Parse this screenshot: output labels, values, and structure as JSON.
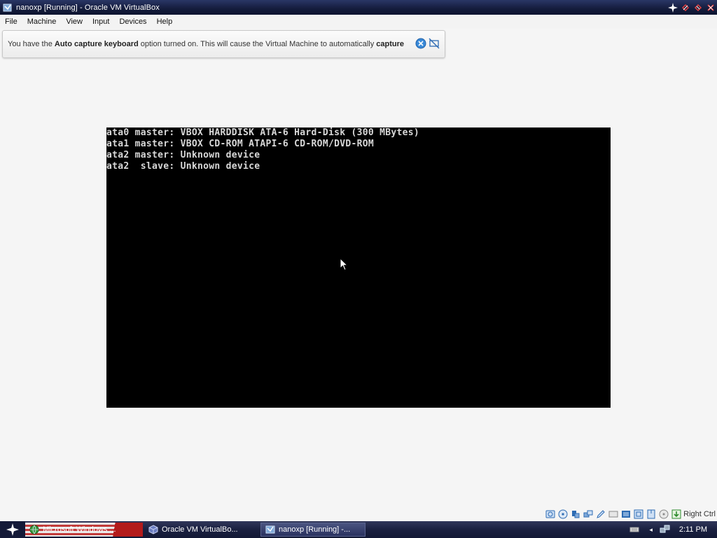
{
  "window": {
    "title": "nanoxp [Running] - Oracle VM VirtualBox"
  },
  "menu": [
    "File",
    "Machine",
    "View",
    "Input",
    "Devices",
    "Help"
  ],
  "notice": {
    "prefix": "You have the ",
    "bold1": "Auto capture keyboard",
    "middle": " option turned on. This will cause the Virtual Machine to automatically ",
    "bold2": "capture"
  },
  "vm_console": {
    "lines": [
      "ata0 master: VBOX HARDDISK ATA-6 Hard-Disk (300 MBytes)",
      "ata1 master: VBOX CD-ROM ATAPI-6 CD-ROM/DVD-ROM",
      "ata2 master: Unknown device",
      "ata2  slave: Unknown device"
    ]
  },
  "statusbar": {
    "host_key": "Right Ctrl",
    "icons": [
      "hard-disk-icon",
      "optical-drive-icon",
      "usb-icon",
      "shared-folders-icon",
      "pencil-icon",
      "display-icon",
      "network-icon",
      "video-capture-icon",
      "mouse-integration-icon",
      "arrow-icon"
    ]
  },
  "taskbar": {
    "items": [
      {
        "label": "Microsoft Windows ..."
      },
      {
        "label": "Oracle VM VirtualBo..."
      },
      {
        "label": "nanoxp [Running] -..."
      }
    ],
    "clock": "2:11 PM"
  },
  "colors": {
    "titlebar": "#141c3c",
    "vm_background": "#000000",
    "console_text": "#d8d8d8",
    "taskbar": "#1a2040"
  }
}
